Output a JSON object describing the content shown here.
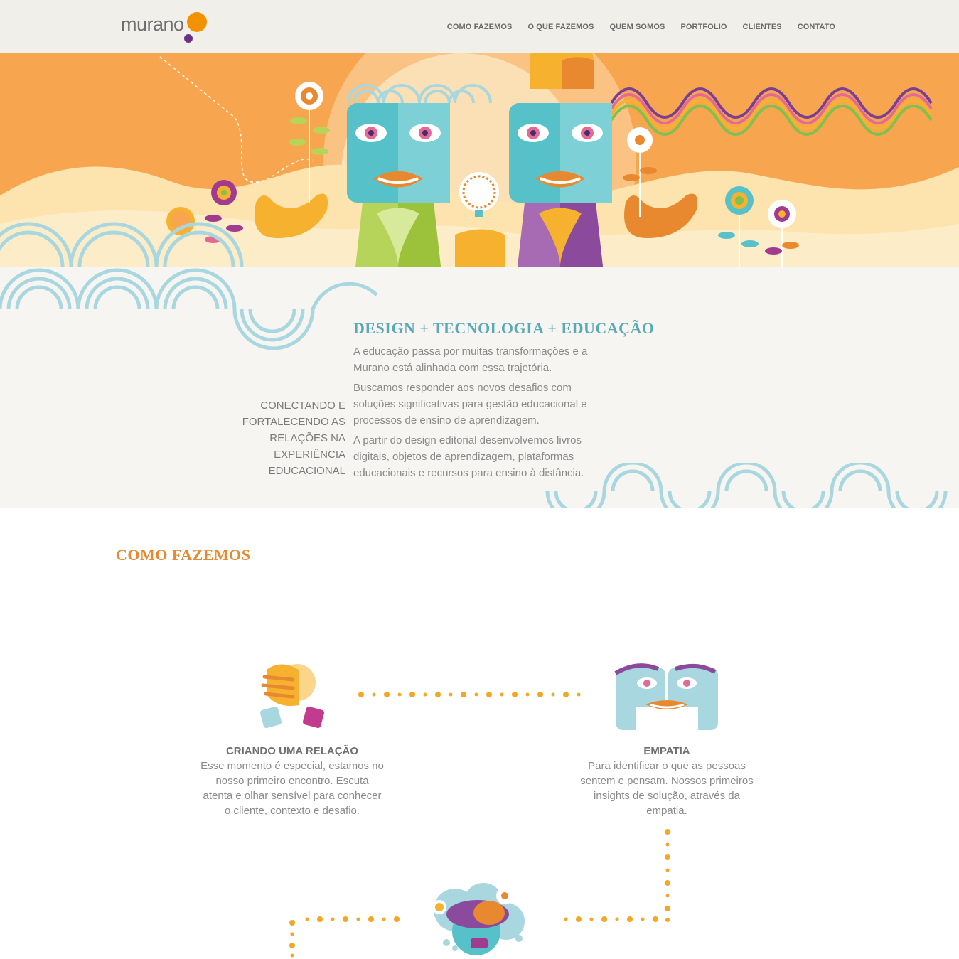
{
  "header": {
    "logo_text": "murano",
    "nav": [
      "COMO FAZEMOS",
      "O QUE FAZEMOS",
      "QUEM SOMOS",
      "PORTFOLIO",
      "CLIENTES",
      "CONTATO"
    ]
  },
  "intro": {
    "tagline_lines": [
      "CONECTANDO E",
      "FORTALECENDO AS",
      "RELAÇÕES NA",
      "EXPERIÊNCIA",
      "EDUCACIONAL"
    ],
    "title": "DESIGN + TECNOLOGIA + EDUCAÇÃO",
    "paragraphs": [
      "A educação passa por muitas transformações e a Murano está alinhada com essa trajetória.",
      "Buscamos responder aos novos desafios com soluções significativas para gestão educacional e processos de ensino de aprendizagem.",
      "A partir do design editorial desenvolvemos livros digitais, objetos de aprendizagem, plataformas educacionais e recursos para ensino à distância."
    ]
  },
  "how": {
    "section_title": "COMO FAZEMOS",
    "steps": [
      {
        "title": "CRIANDO UMA RELAÇÃO",
        "text": "Esse momento é especial, estamos no nosso primeiro encontro. Escuta atenta e olhar sensível para conhecer o cliente, contexto e desafio."
      },
      {
        "title": "EMPATIA",
        "text": "Para identificar o que as pessoas sentem e pensam. Nossos primeiros insights de solução, através da empatia."
      }
    ]
  },
  "colors": {
    "brand_orange": "#f39200",
    "brand_purple": "#6b2f86",
    "accent_teal": "#5aa9b6",
    "section_orange": "#e8882f",
    "dot_orange": "#f6a623",
    "wave_blue": "#a9d7e0"
  },
  "icons": [
    "handshake-icon",
    "empathy-faces-icon",
    "airship-icon"
  ]
}
